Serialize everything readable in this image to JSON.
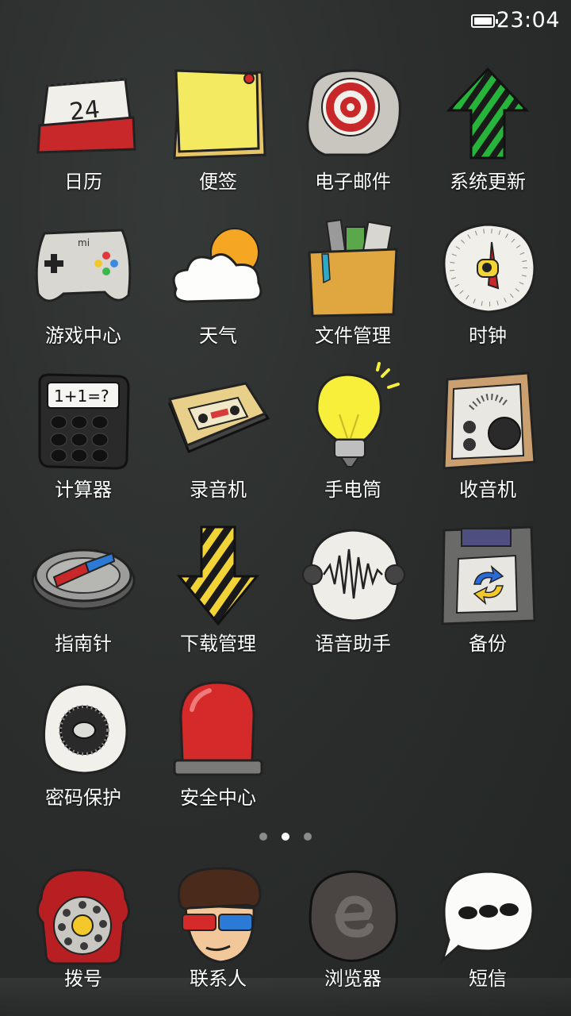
{
  "status_bar": {
    "time": "23:04",
    "battery_level": 1.0
  },
  "apps": [
    {
      "label": "日历",
      "icon": "calendar-icon",
      "date": "24"
    },
    {
      "label": "便签",
      "icon": "notes-icon"
    },
    {
      "label": "电子邮件",
      "icon": "email-icon"
    },
    {
      "label": "系统更新",
      "icon": "system-update-icon"
    },
    {
      "label": "游戏中心",
      "icon": "gamepad-icon",
      "brand": "mi"
    },
    {
      "label": "天气",
      "icon": "weather-icon"
    },
    {
      "label": "文件管理",
      "icon": "file-manager-icon"
    },
    {
      "label": "时钟",
      "icon": "clock-icon"
    },
    {
      "label": "计算器",
      "icon": "calculator-icon",
      "display": "1+1=?"
    },
    {
      "label": "录音机",
      "icon": "cassette-icon"
    },
    {
      "label": "手电筒",
      "icon": "lightbulb-icon"
    },
    {
      "label": "收音机",
      "icon": "radio-icon"
    },
    {
      "label": "指南针",
      "icon": "compass-icon"
    },
    {
      "label": "下载管理",
      "icon": "download-arrow-icon"
    },
    {
      "label": "语音助手",
      "icon": "voice-wave-icon"
    },
    {
      "label": "备份",
      "icon": "backup-disk-icon"
    },
    {
      "label": "密码保护",
      "icon": "password-lock-icon"
    },
    {
      "label": "安全中心",
      "icon": "alarm-light-icon"
    }
  ],
  "page_indicator": {
    "count": 3,
    "active_index": 1
  },
  "dock": [
    {
      "label": "拨号",
      "icon": "rotary-phone-icon"
    },
    {
      "label": "联系人",
      "icon": "contact-face-icon"
    },
    {
      "label": "浏览器",
      "icon": "browser-icon"
    },
    {
      "label": "短信",
      "icon": "message-bubble-icon"
    }
  ],
  "colors": {
    "background": "#2a2d2c",
    "label": "#ffffff",
    "accent_red": "#c8282a",
    "accent_green": "#27b43a",
    "accent_yellow": "#f2d436"
  }
}
